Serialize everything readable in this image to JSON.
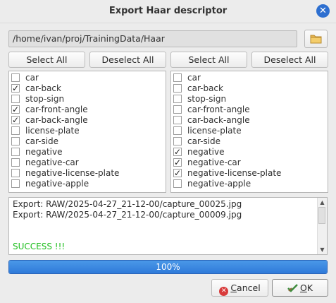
{
  "window": {
    "title": "Export Haar descriptor"
  },
  "path": {
    "value": "/home/ivan/proj/TrainingData/Haar"
  },
  "left_panel": {
    "select_all_label": "Select All",
    "deselect_all_label": "Deselect All",
    "items": [
      {
        "label": "car",
        "checked": false
      },
      {
        "label": "car-back",
        "checked": true
      },
      {
        "label": "stop-sign",
        "checked": false
      },
      {
        "label": "car-front-angle",
        "checked": true
      },
      {
        "label": "car-back-angle",
        "checked": true
      },
      {
        "label": "license-plate",
        "checked": false
      },
      {
        "label": "car-side",
        "checked": false
      },
      {
        "label": "negative",
        "checked": false
      },
      {
        "label": "negative-car",
        "checked": false
      },
      {
        "label": "negative-license-plate",
        "checked": false
      },
      {
        "label": "negative-apple",
        "checked": false
      }
    ]
  },
  "right_panel": {
    "select_all_label": "Select All",
    "deselect_all_label": "Deselect All",
    "items": [
      {
        "label": "car",
        "checked": false
      },
      {
        "label": "car-back",
        "checked": false
      },
      {
        "label": "stop-sign",
        "checked": false
      },
      {
        "label": "car-front-angle",
        "checked": false
      },
      {
        "label": "car-back-angle",
        "checked": false
      },
      {
        "label": "license-plate",
        "checked": false
      },
      {
        "label": "car-side",
        "checked": false
      },
      {
        "label": "negative",
        "checked": true
      },
      {
        "label": "negative-car",
        "checked": true
      },
      {
        "label": "negative-license-plate",
        "checked": true
      },
      {
        "label": "negative-apple",
        "checked": false
      }
    ]
  },
  "log": {
    "lines": [
      "Export: RAW/2025-04-27_21-12-00/capture_00025.jpg",
      "Export: RAW/2025-04-27_21-12-00/capture_00009.jpg"
    ],
    "status": "SUCCESS !!!",
    "status_color": "#1fbf1f"
  },
  "progress": {
    "value": 1.0,
    "label": "100%"
  },
  "buttons": {
    "cancel_first": "C",
    "cancel_rest": "ancel",
    "ok_first": "O",
    "ok_rest": "K"
  },
  "icons": {
    "close": "close-icon",
    "folder": "folder-icon",
    "cancel": "cancel-icon",
    "ok": "ok-icon"
  },
  "colors": {
    "accent": "#2d6fd0",
    "progress_fill": "#3b86df",
    "cancel_icon": "#d83b3b",
    "ok_icon": "#3d8c3d"
  }
}
